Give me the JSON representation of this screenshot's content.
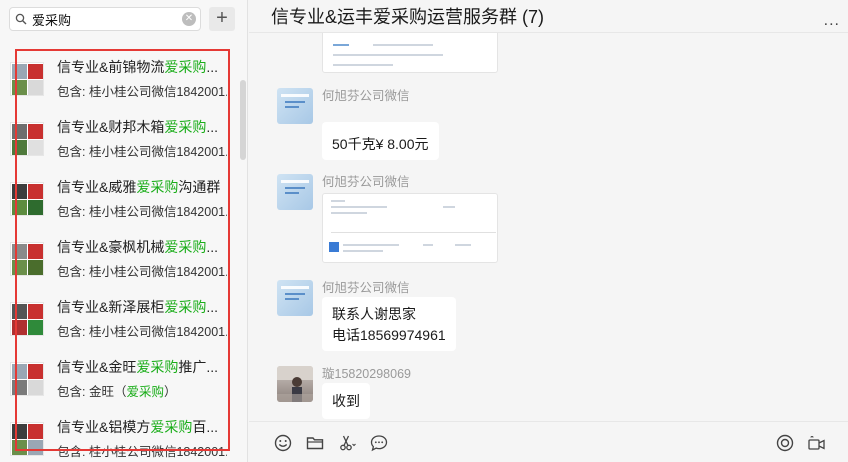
{
  "search": {
    "value": "爱采购",
    "clear_symbol": "✕"
  },
  "add_button_label": "+",
  "results": [
    {
      "title_pre": "信专业&前锦物流",
      "title_hl": "爱采购",
      "title_post": "...",
      "sub_pre": "包含: 桂小桂公司微信1842001...",
      "sub_hl": "",
      "sub_post": ""
    },
    {
      "title_pre": "信专业&财邦木箱",
      "title_hl": "爱采购",
      "title_post": "...",
      "sub_pre": "包含: 桂小桂公司微信1842001...",
      "sub_hl": "",
      "sub_post": ""
    },
    {
      "title_pre": "信专业&威雅",
      "title_hl": "爱采购",
      "title_post": "沟通群",
      "sub_pre": "包含: 桂小桂公司微信1842001...",
      "sub_hl": "",
      "sub_post": ""
    },
    {
      "title_pre": "信专业&豪枫机械",
      "title_hl": "爱采购",
      "title_post": "...",
      "sub_pre": "包含: 桂小桂公司微信1842001...",
      "sub_hl": "",
      "sub_post": ""
    },
    {
      "title_pre": "信专业&新泽展柜",
      "title_hl": "爱采购",
      "title_post": "...",
      "sub_pre": "包含: 桂小桂公司微信1842001...",
      "sub_hl": "",
      "sub_post": ""
    },
    {
      "title_pre": "信专业&金旺",
      "title_hl": "爱采购",
      "title_post": "推广...",
      "sub_pre": "包含: 金旺（",
      "sub_hl": "爱采购",
      "sub_post": "）"
    },
    {
      "title_pre": "信专业&铝模方",
      "title_hl": "爱采购",
      "title_post": "百...",
      "sub_pre": "包含: 桂小桂公司微信1842001...",
      "sub_hl": "",
      "sub_post": ""
    }
  ],
  "chat": {
    "title": "信专业&运丰爱采购运营服务群 (7)",
    "more_label": "...",
    "messages": [
      {
        "sender": "何旭芬公司微信",
        "text": "50千克¥ 8.00元"
      },
      {
        "sender": "何旭芬公司微信",
        "text": ""
      },
      {
        "sender": "何旭芬公司微信",
        "text_line1": "联系人谢思家",
        "text_line2": "电话18569974961"
      },
      {
        "sender": "璇15820298069",
        "text": "收到"
      }
    ]
  },
  "toolbar_icons": [
    "emoji-icon",
    "folder-icon",
    "scissors-icon",
    "chat-bubble-icon",
    "live-icon",
    "video-call-icon"
  ],
  "colors": {
    "highlight": "#1aad19",
    "red_box": "#e53935",
    "background": "#f5f5f5"
  }
}
